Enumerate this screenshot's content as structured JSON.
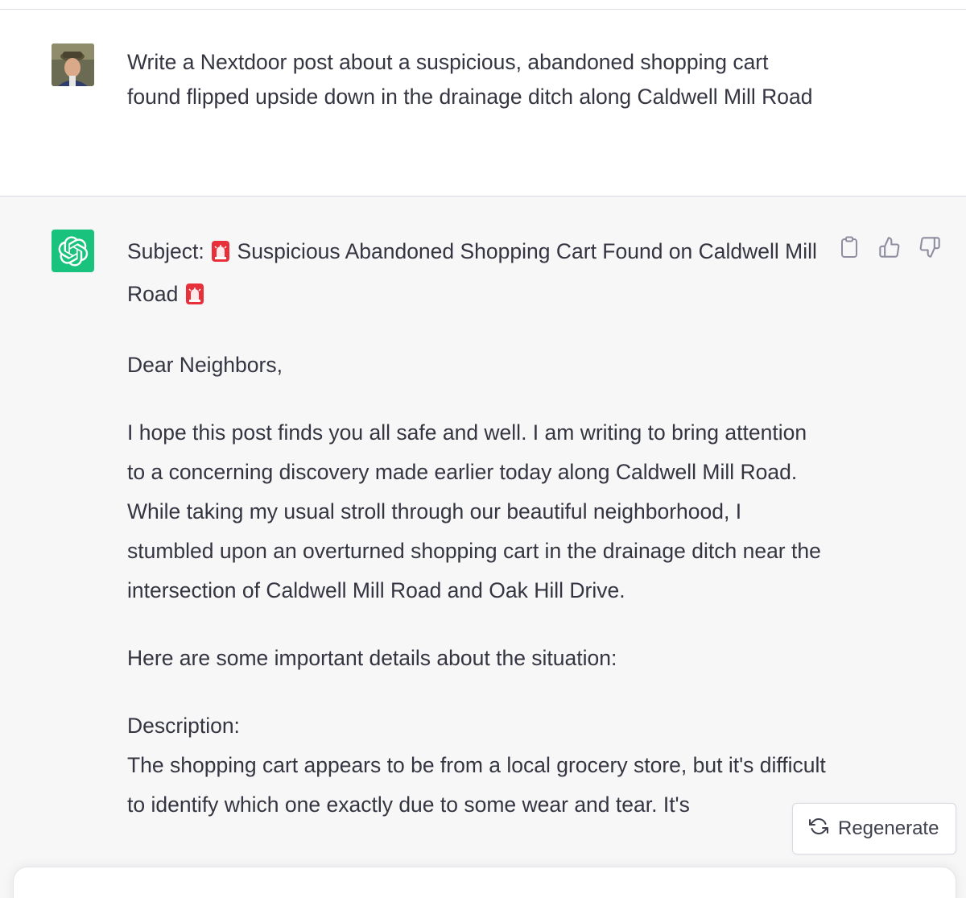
{
  "user": {
    "message": "Write a Nextdoor post about a suspicious, abandoned shopping cart found flipped upside down in the drainage ditch along Caldwell Mill Road"
  },
  "assistant": {
    "subject_prefix": "Subject:",
    "subject_emoji": "🚨",
    "subject_text": "Suspicious Abandoned Shopping Cart Found on Caldwell Mill Road",
    "greeting": "Dear Neighbors,",
    "paragraph1": "I hope this post finds you all safe and well. I am writing to bring attention to a concerning discovery made earlier today along Caldwell Mill Road. While taking my usual stroll through our beautiful neighborhood, I stumbled upon an overturned shopping cart in the drainage ditch near the intersection of Caldwell Mill Road and Oak Hill Drive.",
    "paragraph2": "Here are some important details about the situation:",
    "description_label": "Description:",
    "description_text": "The shopping cart appears to be from a local grocery store, but it's difficult to identify which one exactly due to some wear and tear. It's"
  },
  "actions": {
    "copy_icon": "clipboard-icon",
    "like_icon": "thumbs-up-icon",
    "dislike_icon": "thumbs-down-icon"
  },
  "regenerate": {
    "label": "Regenerate",
    "icon": "refresh-icon"
  },
  "colors": {
    "accent": "#19c37d",
    "assistant_bg": "#f7f7f8",
    "text": "#343541"
  }
}
